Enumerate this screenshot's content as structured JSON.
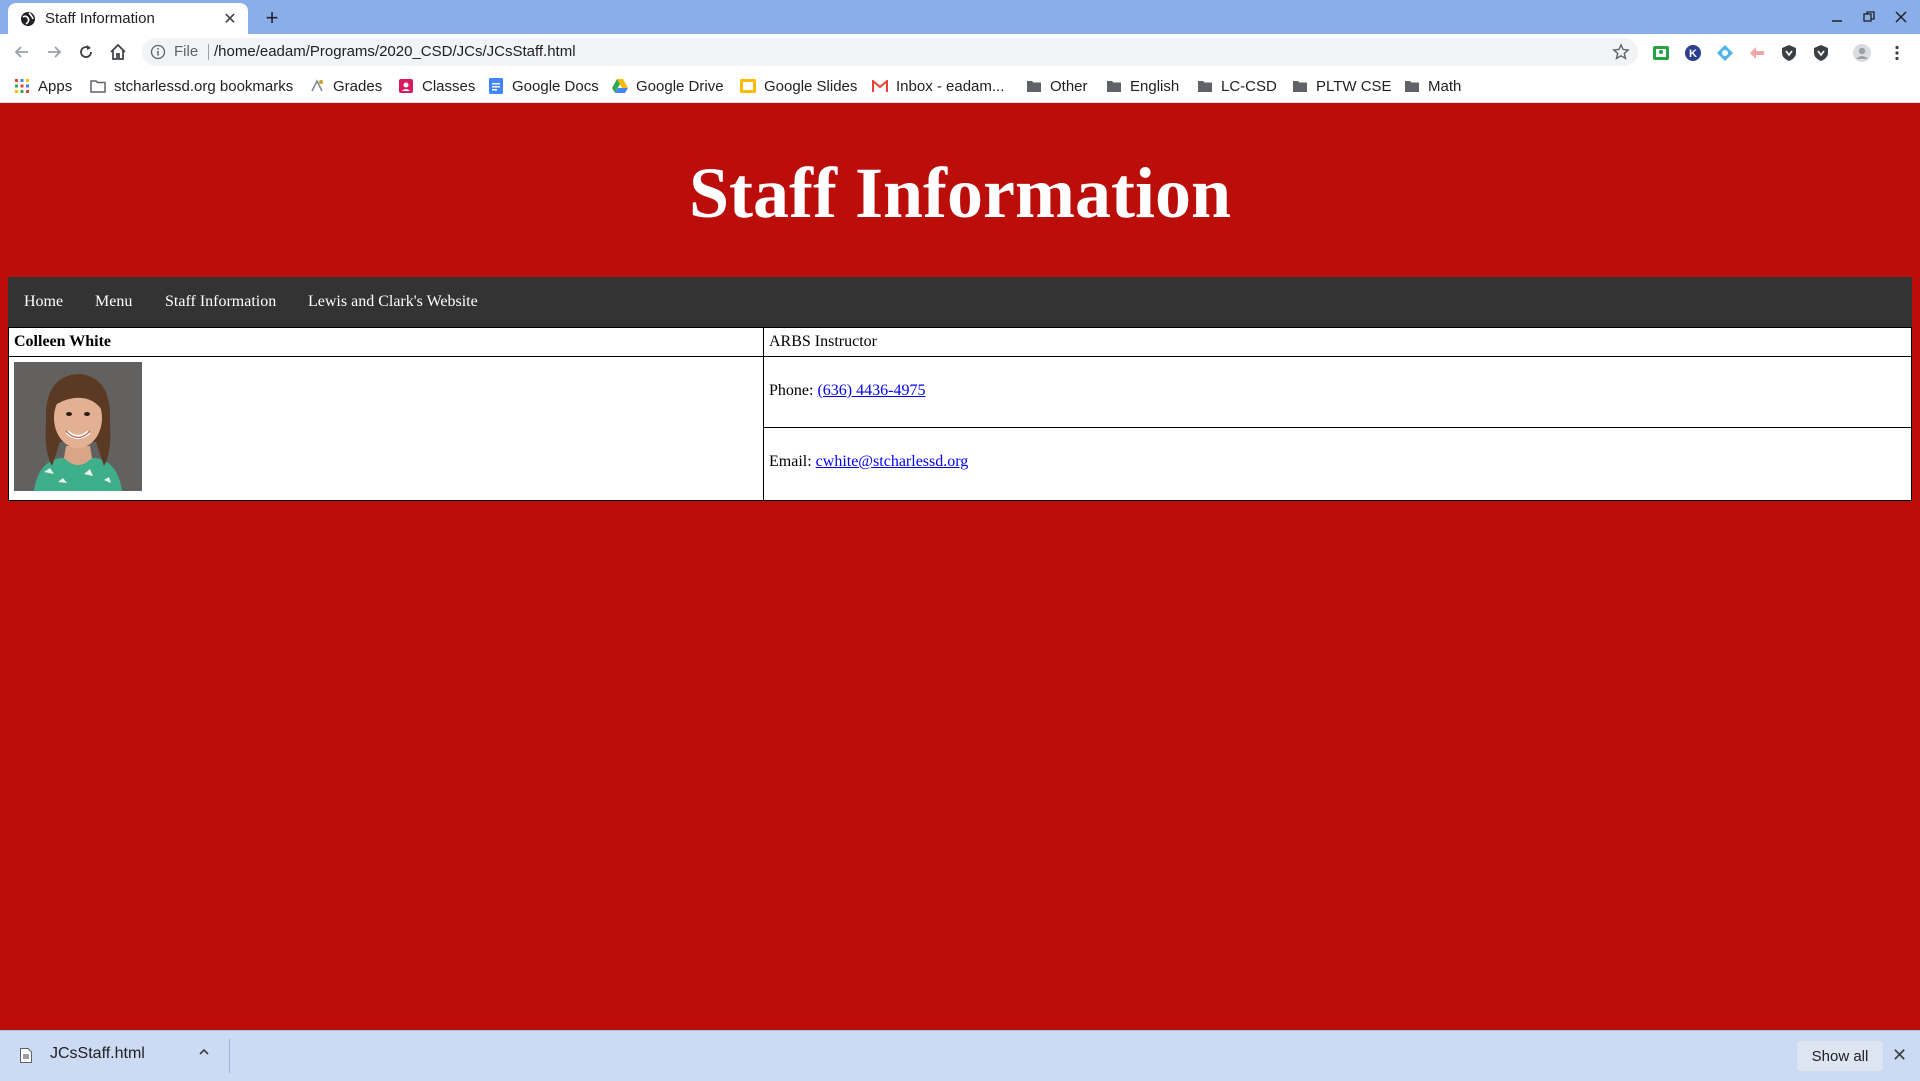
{
  "browser": {
    "tab_title": "Staff Information",
    "tab_close": "✕",
    "new_tab": "+",
    "omnibox_scheme": "File",
    "url": "/home/eadam/Programs/2020_CSD/JCs/JCsStaff.html",
    "bookmarks": [
      {
        "label": "Apps",
        "icon": "apps-grid-icon"
      },
      {
        "label": "stcharlessd.org bookmarks",
        "icon": "folder-icon"
      },
      {
        "label": "Grades",
        "icon": "grades-icon"
      },
      {
        "label": "Classes",
        "icon": "classroom-icon"
      },
      {
        "label": "Google Docs",
        "icon": "google-docs-icon"
      },
      {
        "label": "Google Drive",
        "icon": "google-drive-icon"
      },
      {
        "label": "Google Slides",
        "icon": "google-slides-icon"
      },
      {
        "label": "Inbox - eadam...",
        "icon": "gmail-icon"
      },
      {
        "label": "Other",
        "icon": "folder-icon"
      },
      {
        "label": "English",
        "icon": "folder-icon"
      },
      {
        "label": "LC-CSD",
        "icon": "folder-icon"
      },
      {
        "label": "PLTW CSE",
        "icon": "folder-icon"
      },
      {
        "label": "Math",
        "icon": "folder-icon"
      }
    ]
  },
  "page": {
    "heading": "Staff Information",
    "nav": [
      "Home",
      "Menu",
      "Staff Information",
      "Lewis and Clark's Website"
    ],
    "staff": {
      "name": "Colleen White",
      "role": "ARBS Instructor",
      "phone_label": "Phone:",
      "phone": "(636) 4436-4975",
      "email_label": "Email:",
      "email": "cwhite@stcharlessd.org"
    }
  },
  "downloads": {
    "file": "JCsStaff.html",
    "show_all": "Show all",
    "close": "✕"
  },
  "colors": {
    "page_background": "#bb0d0a",
    "navbar": "#333333",
    "tabbar": "#8aaeea",
    "download_bar": "#ccdaf3"
  }
}
